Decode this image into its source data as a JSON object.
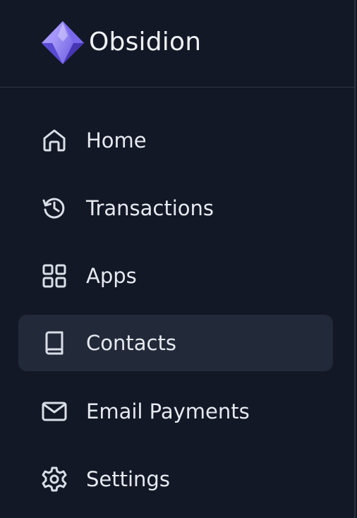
{
  "brand": {
    "name": "Obsidion",
    "logo_icon": "diamond-gem-icon"
  },
  "colors": {
    "background": "#131826",
    "active_background": "#222a39",
    "text": "#e6e9ef",
    "icon": "#d9dee7",
    "divider": "#2f3644",
    "accent": "#7c6cf0"
  },
  "nav": {
    "active_item": "Contacts",
    "items": [
      {
        "label": "Home",
        "icon": "home-icon"
      },
      {
        "label": "Transactions",
        "icon": "history-icon"
      },
      {
        "label": "Apps",
        "icon": "grid-icon"
      },
      {
        "label": "Contacts",
        "icon": "book-icon"
      },
      {
        "label": "Email Payments",
        "icon": "mail-icon"
      },
      {
        "label": "Settings",
        "icon": "gear-icon"
      }
    ]
  }
}
